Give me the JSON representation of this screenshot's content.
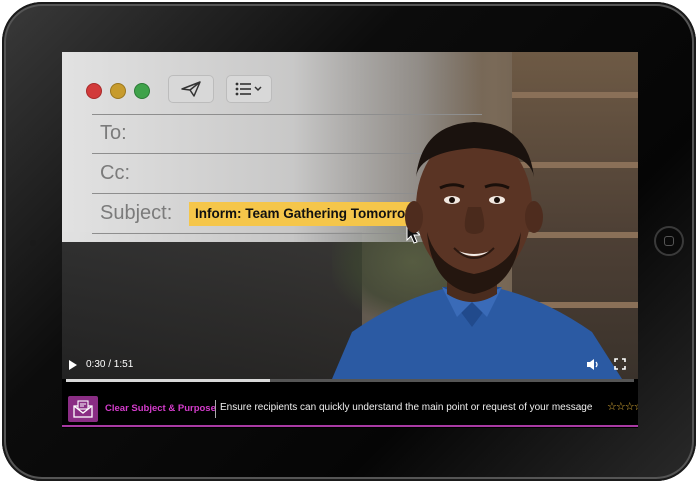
{
  "email": {
    "to_label": "To:",
    "cc_label": "Cc:",
    "subject_label": "Subject:",
    "subject_value": "Inform: Team Gathering Tomorrow",
    "toolbar": {
      "send_icon": "paper-plane-icon",
      "format_icon": "list-icon"
    }
  },
  "player": {
    "time": "0:30 / 1:51",
    "progress": 0.36
  },
  "tip": {
    "title": "Clear Subject & Purpose",
    "description": "Ensure recipients can quickly understand the main point or request of your message",
    "stars": "☆☆☆☆",
    "icon": "envelope-icon"
  },
  "colors": {
    "highlight": "#f5c64a",
    "accent": "#d43ccb",
    "icon_bg": "#8a2d84",
    "stars": "#e8b73a"
  }
}
